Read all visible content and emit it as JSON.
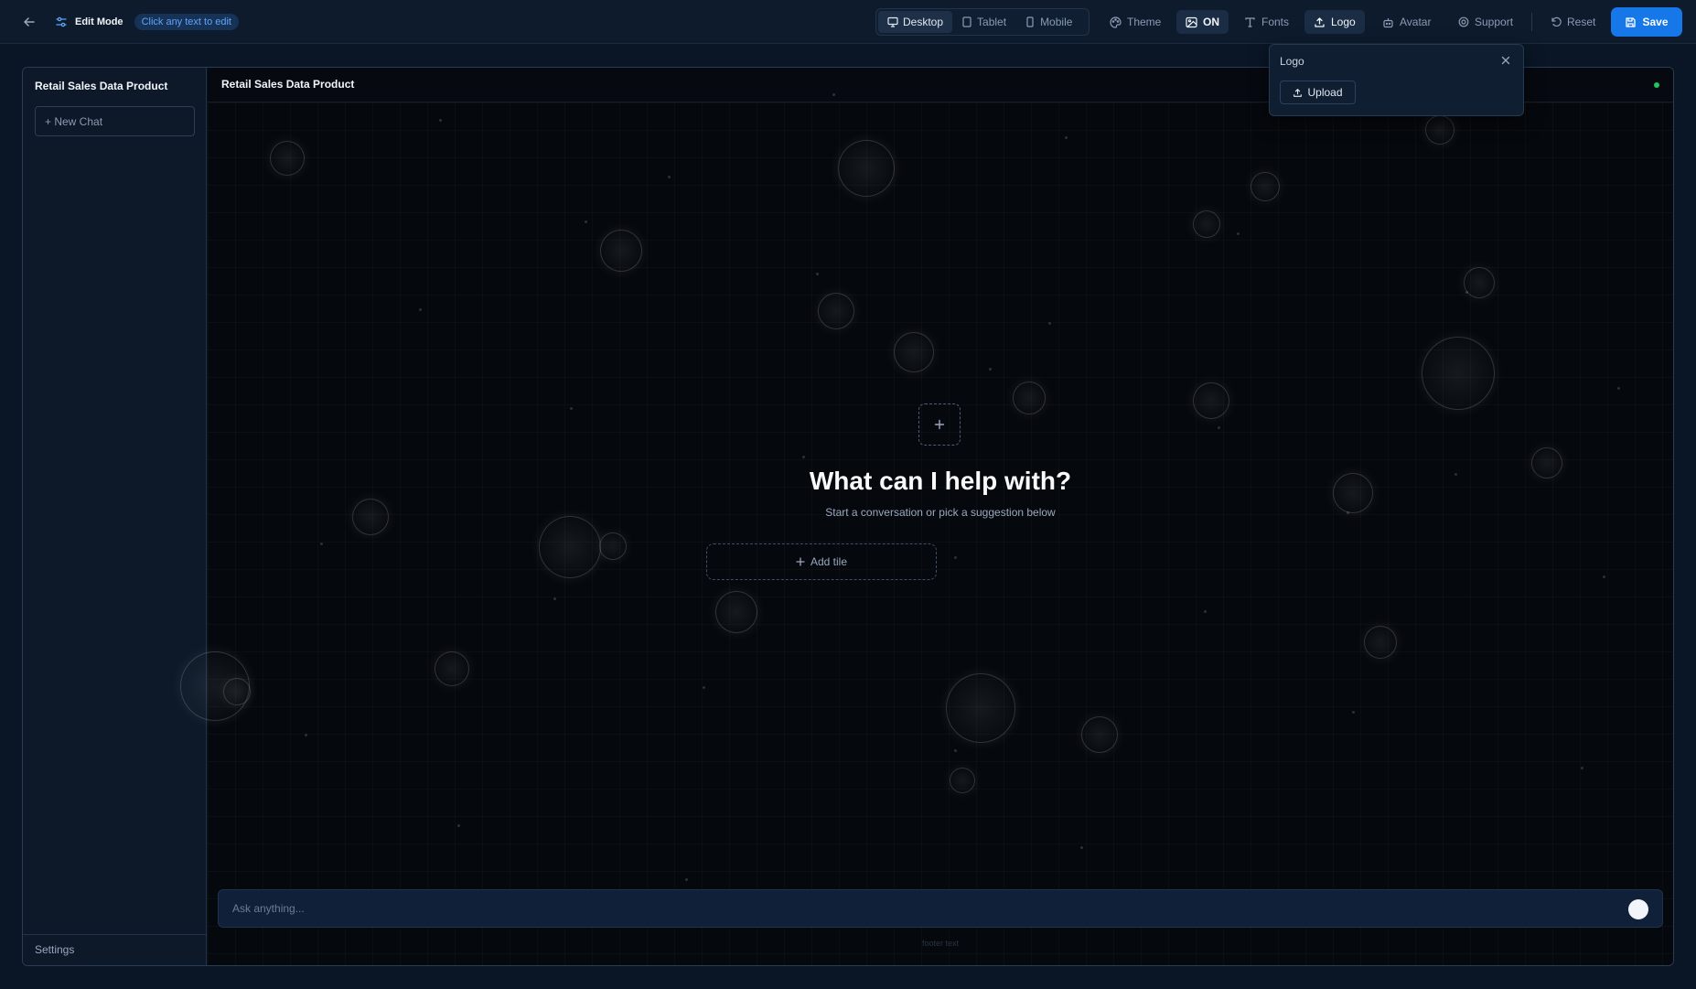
{
  "toolbar": {
    "edit_mode_label": "Edit Mode",
    "edit_hint": "Click any text to edit",
    "devices": [
      {
        "label": "Desktop",
        "icon": "monitor-icon",
        "active": true
      },
      {
        "label": "Tablet",
        "icon": "tablet-icon",
        "active": false
      },
      {
        "label": "Mobile",
        "icon": "smartphone-icon",
        "active": false
      }
    ],
    "theme_label": "Theme",
    "background_toggle_label": "ON",
    "fonts_label": "Fonts",
    "logo_label": "Logo",
    "avatar_label": "Avatar",
    "support_label": "Support",
    "reset_label": "Reset",
    "save_label": "Save"
  },
  "logo_popover": {
    "title": "Logo",
    "upload_label": "Upload"
  },
  "sidebar": {
    "title": "Retail Sales Data Product",
    "new_chat_label": "+ New Chat",
    "settings_label": "Settings"
  },
  "main": {
    "header_title": "Retail Sales Data Product",
    "hero_title": "What can I help with?",
    "hero_subtitle": "Start a conversation or pick a suggestion below",
    "add_tile_label": "Add tile",
    "input_placeholder": "Ask anything...",
    "footer_text": "footer text"
  },
  "colors": {
    "accent": "#1677e8",
    "status_online": "#22c55e",
    "background": "#0a1626"
  }
}
